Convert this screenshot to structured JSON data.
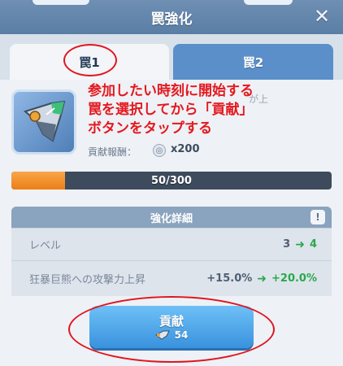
{
  "header": {
    "title": "罠強化",
    "close_icon": "close-icon"
  },
  "tabs": [
    {
      "label": "罠1",
      "selected": true
    },
    {
      "label": "罠2",
      "selected": false
    }
  ],
  "item": {
    "icon": "shield-blade-icon",
    "description_partial": "が上",
    "reward_label": "貢献報酬：",
    "reward_icon": "coin-icon",
    "reward_count": "x200"
  },
  "annotation": {
    "lines": [
      "参加したい時刻に開始する",
      "罠を選択してから「貢献」",
      "ボタンをタップする"
    ],
    "color": "#e3191f"
  },
  "progress": {
    "text": "50/300",
    "fraction": 0.1667
  },
  "details": {
    "title": "強化詳細",
    "info_label": "!",
    "rows": [
      {
        "label": "レベル",
        "from": "3",
        "to": "4"
      },
      {
        "label": "狂暴巨熊への攻撃力上昇",
        "from": "+15.0%",
        "to": "+20.0%"
      }
    ]
  },
  "contribute": {
    "label": "貢献",
    "cost_icon": "trap-item-icon",
    "cost": "54"
  }
}
